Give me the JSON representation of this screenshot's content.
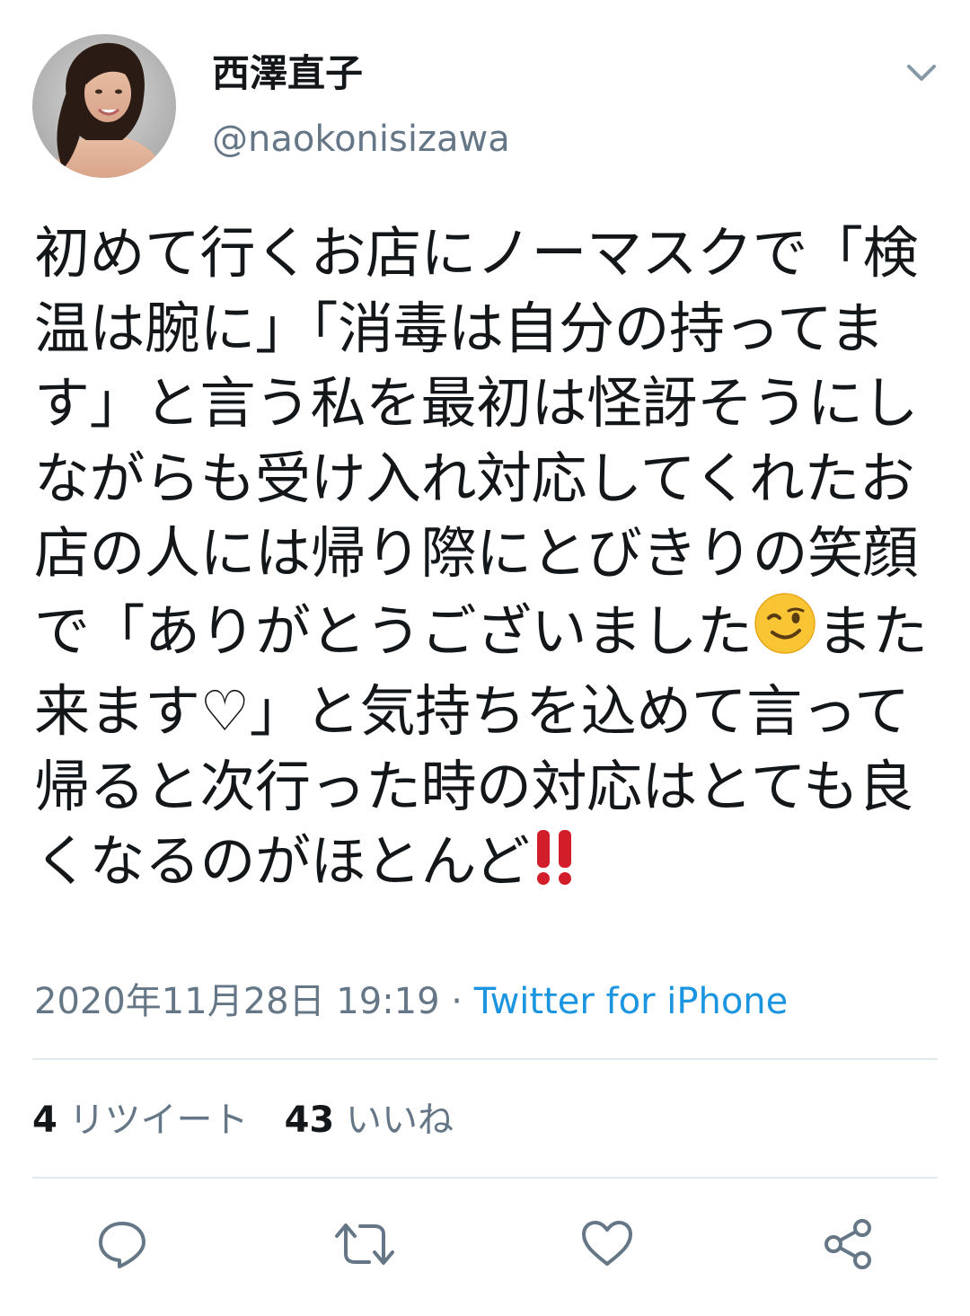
{
  "user": {
    "display_name": "西澤直子",
    "handle": "@naokonisizawa",
    "avatar": "profile-photo"
  },
  "tweet": {
    "text_before_wink": "初めて行くお店にノーマスクで「検温は腕に」「消毒は自分の持ってます」と言う私を最初は怪訝そうにしながらも受け入れ対応してくれたお店の人には帰り際にとびきりの笑顔で「ありがとうございました",
    "text_between": "また来ます♡」と気持ちを込めて言って帰ると次行った時の対応はとても良くなるのがほとんど",
    "emojis": [
      "winking-face-emoji",
      "double-exclamation-emoji"
    ]
  },
  "meta": {
    "timestamp": "2020年11月28日 19:19",
    "separator": " · ",
    "source": "Twitter for iPhone"
  },
  "stats": {
    "retweets_count": "4",
    "retweets_label": "リツイート",
    "likes_count": "43",
    "likes_label": "いいね"
  },
  "icons": {
    "menu": "chevron-down-icon",
    "reply": "reply-icon",
    "retweet": "retweet-icon",
    "like": "heart-icon",
    "share": "share-icon"
  },
  "colors": {
    "text": "#14171a",
    "secondary": "#657786",
    "link": "#1b95e0",
    "divider": "#e1e8ed",
    "icon": "#657786"
  }
}
